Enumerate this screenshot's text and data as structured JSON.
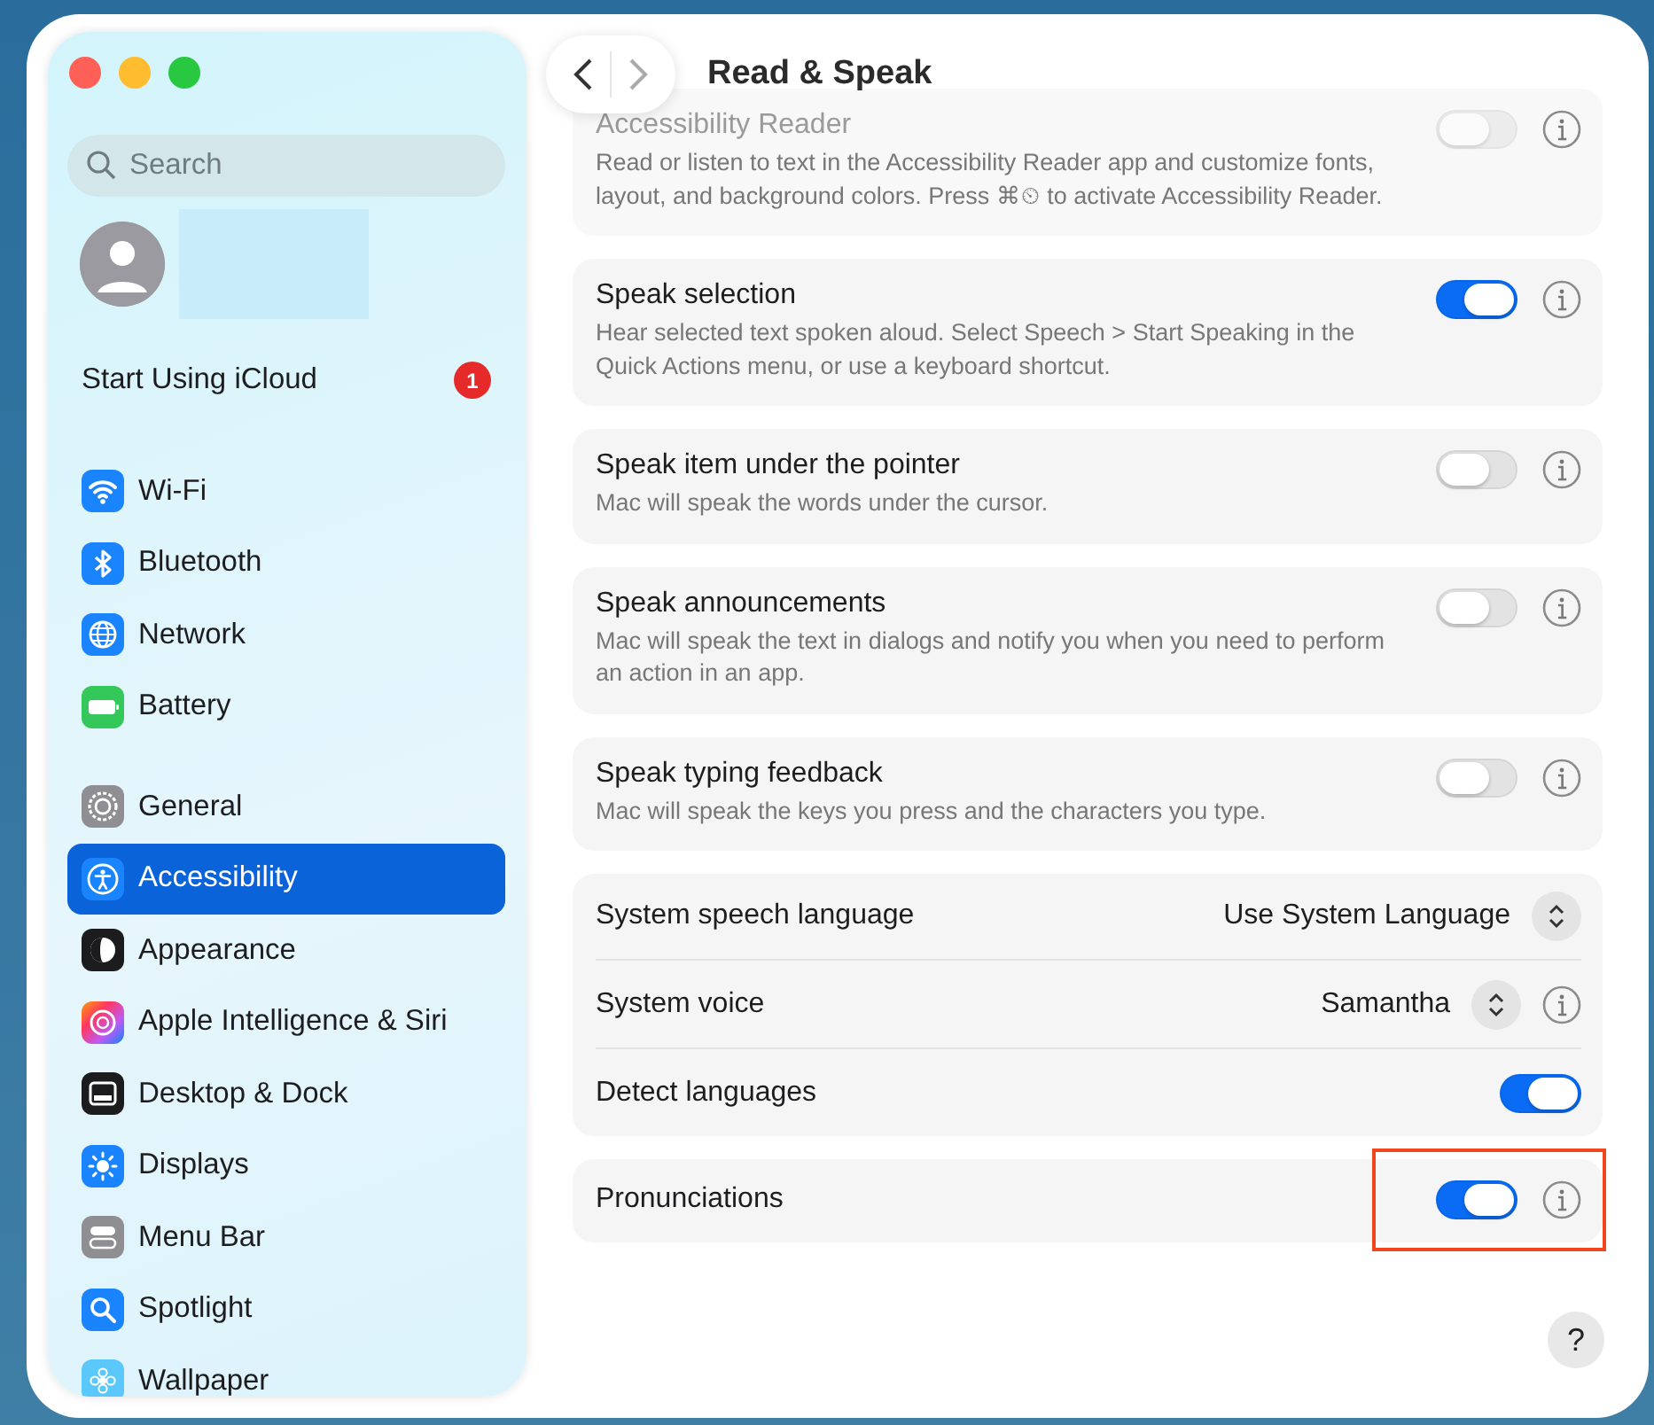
{
  "sidebar": {
    "search": {
      "placeholder": "Search"
    },
    "account": {
      "label": "Start Using iCloud",
      "badge": "1"
    },
    "groups": [
      [
        {
          "label": "Wi-Fi",
          "kind": "wifi",
          "selected": false
        },
        {
          "label": "Bluetooth",
          "kind": "bluetooth",
          "selected": false
        },
        {
          "label": "Network",
          "kind": "network",
          "selected": false
        },
        {
          "label": "Battery",
          "kind": "battery",
          "selected": false
        }
      ],
      [
        {
          "label": "General",
          "kind": "general",
          "selected": false
        },
        {
          "label": "Accessibility",
          "kind": "accessibility",
          "selected": true
        },
        {
          "label": "Appearance",
          "kind": "appearance",
          "selected": false
        },
        {
          "label": "Apple Intelligence & Siri",
          "kind": "siri",
          "selected": false
        },
        {
          "label": "Desktop & Dock",
          "kind": "desktop",
          "selected": false
        },
        {
          "label": "Displays",
          "kind": "displays",
          "selected": false
        },
        {
          "label": "Menu Bar",
          "kind": "menubar",
          "selected": false
        },
        {
          "label": "Spotlight",
          "kind": "spotlight",
          "selected": false
        },
        {
          "label": "Wallpaper",
          "kind": "wallpaper",
          "selected": false
        }
      ]
    ]
  },
  "content": {
    "title": "Read & Speak",
    "sections": [
      {
        "kind": "toggle_card",
        "title": "Accessibility Reader",
        "description": "Read or listen to text in the Accessibility Reader app and customize fonts, layout, and background colors. Press ⌘⏲ to activate Accessibility Reader.",
        "on": false,
        "faded": true,
        "highlighted": false
      },
      {
        "kind": "toggle_card",
        "title": "Speak selection",
        "description": "Hear selected text spoken aloud. Select Speech > Start Speaking in the Quick Actions menu, or use a keyboard shortcut.",
        "on": true,
        "faded": false,
        "highlighted": false
      },
      {
        "kind": "toggle_card",
        "title": "Speak item under the pointer",
        "description": "Mac will speak the words under the cursor.",
        "on": false,
        "faded": false,
        "highlighted": false
      },
      {
        "kind": "toggle_card",
        "title": "Speak announcements",
        "description": "Mac will speak the text in dialogs and notify you when you need to perform an action in an app.",
        "on": false,
        "faded": false,
        "highlighted": false
      },
      {
        "kind": "toggle_card",
        "title": "Speak typing feedback",
        "description": "Mac will speak the keys you press and the characters you type.",
        "on": false,
        "faded": false,
        "highlighted": false
      },
      {
        "kind": "group",
        "rows": [
          {
            "kind": "popup",
            "label": "System speech language",
            "value": "Use System Language"
          },
          {
            "kind": "popup_info",
            "label": "System voice",
            "value": "Samantha"
          },
          {
            "kind": "toggle",
            "label": "Detect languages",
            "on": true
          }
        ]
      },
      {
        "kind": "toggle_card",
        "title": "Pronunciations",
        "on": true,
        "faded": false,
        "highlighted": true
      }
    ],
    "help": "?"
  }
}
